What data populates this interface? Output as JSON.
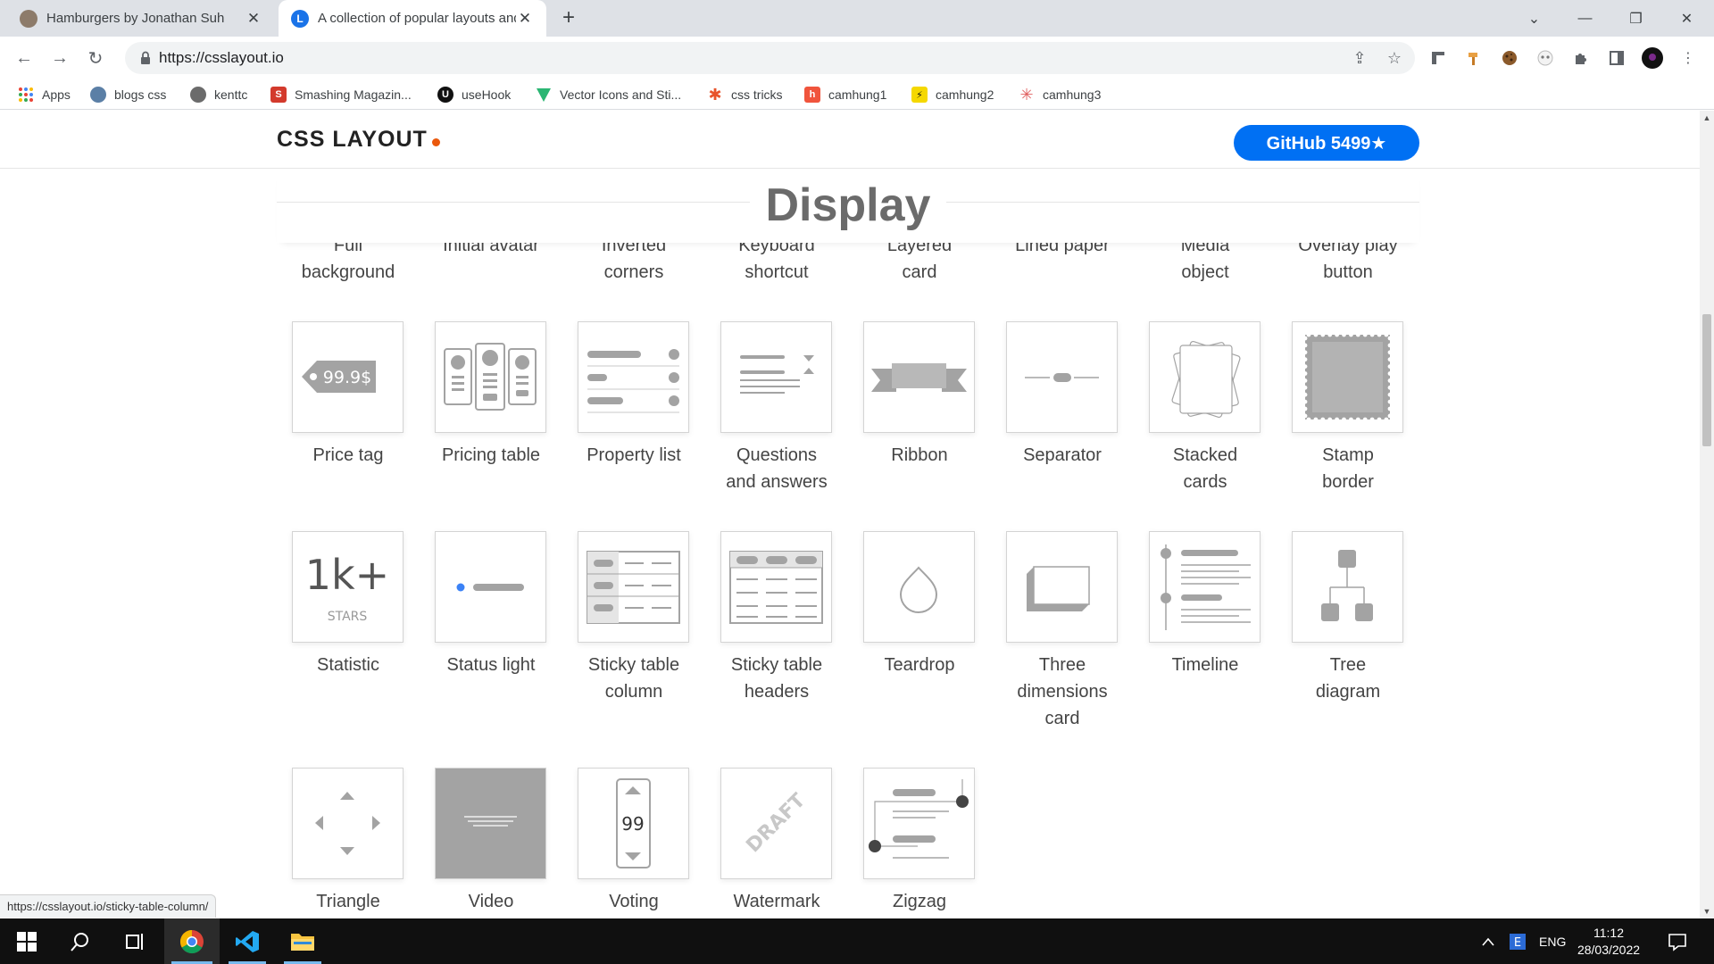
{
  "browser": {
    "tabs": [
      {
        "title": "Hamburgers by Jonathan Suh",
        "active": false
      },
      {
        "title": "A collection of popular layouts and patterns made with CSS",
        "active": true
      }
    ],
    "url": "https://csslayout.io",
    "bookmarks": [
      {
        "label": "Apps",
        "icon": "apps-grid-icon"
      },
      {
        "label": "blogs css",
        "icon": "globe-icon"
      },
      {
        "label": "kenttc",
        "icon": "koala-icon"
      },
      {
        "label": "Smashing Magazin...",
        "icon": "smashing-icon"
      },
      {
        "label": "useHook",
        "icon": "usehook-icon"
      },
      {
        "label": "Vector Icons and Sti...",
        "icon": "vector-icon"
      },
      {
        "label": "css tricks",
        "icon": "star-icon"
      },
      {
        "label": "camhung1",
        "icon": "h-icon"
      },
      {
        "label": "camhung2",
        "icon": "lightning-icon"
      },
      {
        "label": "camhung3",
        "icon": "leaf-icon"
      }
    ],
    "status_url": "https://csslayout.io/sticky-table-column/"
  },
  "site": {
    "brand": "CSS LAYOUT",
    "github_label": "GitHub 5499★",
    "section_title": "Display",
    "top_row": [
      {
        "line1": "Full",
        "line2": "background"
      },
      {
        "line1": "Initial avatar",
        "line2": ""
      },
      {
        "line1": "Inverted",
        "line2": "corners"
      },
      {
        "line1": "Keyboard",
        "line2": "shortcut"
      },
      {
        "line1": "Layered",
        "line2": "card"
      },
      {
        "line1": "Lined paper",
        "line2": ""
      },
      {
        "line1": "Media",
        "line2": "object"
      },
      {
        "line1": "Overlay play",
        "line2": "button"
      }
    ],
    "patterns": [
      {
        "name": "price-tag",
        "line1": "Price tag",
        "line2": "",
        "line3": "",
        "tag_text": "99.9$"
      },
      {
        "name": "pricing-table",
        "line1": "Pricing table",
        "line2": "",
        "line3": ""
      },
      {
        "name": "property-list",
        "line1": "Property list",
        "line2": "",
        "line3": ""
      },
      {
        "name": "questions-and-answers",
        "line1": "Questions",
        "line2": "and answers",
        "line3": ""
      },
      {
        "name": "ribbon",
        "line1": "Ribbon",
        "line2": "",
        "line3": ""
      },
      {
        "name": "separator",
        "line1": "Separator",
        "line2": "",
        "line3": ""
      },
      {
        "name": "stacked-cards",
        "line1": "Stacked",
        "line2": "cards",
        "line3": ""
      },
      {
        "name": "stamp-border",
        "line1": "Stamp",
        "line2": "border",
        "line3": ""
      },
      {
        "name": "statistic",
        "line1": "Statistic",
        "line2": "",
        "line3": "",
        "stat_value": "1k+",
        "stat_unit": "STARS"
      },
      {
        "name": "status-light",
        "line1": "Status light",
        "line2": "",
        "line3": ""
      },
      {
        "name": "sticky-table-column",
        "line1": "Sticky table",
        "line2": "column",
        "line3": ""
      },
      {
        "name": "sticky-table-headers",
        "line1": "Sticky table",
        "line2": "headers",
        "line3": ""
      },
      {
        "name": "teardrop",
        "line1": "Teardrop",
        "line2": "",
        "line3": ""
      },
      {
        "name": "three-dimensions-card",
        "line1": "Three",
        "line2": "dimensions",
        "line3": "card"
      },
      {
        "name": "timeline",
        "line1": "Timeline",
        "line2": "",
        "line3": ""
      },
      {
        "name": "tree-diagram",
        "line1": "Tree",
        "line2": "diagram",
        "line3": ""
      },
      {
        "name": "triangle",
        "line1": "Triangle",
        "line2": "",
        "line3": ""
      },
      {
        "name": "video",
        "line1": "Video",
        "line2": "",
        "line3": ""
      },
      {
        "name": "voting",
        "line1": "Voting",
        "line2": "",
        "line3": "",
        "vote_value": "99"
      },
      {
        "name": "watermark",
        "line1": "Watermark",
        "line2": "",
        "line3": "",
        "watermark_text": "DRAFT"
      },
      {
        "name": "zigzag",
        "line1": "Zigzag",
        "line2": "",
        "line3": ""
      }
    ]
  },
  "taskbar": {
    "language": "ENG",
    "time": "11:12",
    "date": "28/03/2022"
  },
  "colors": {
    "accent": "#0070f3",
    "brand_dot": "#ea580c",
    "pattern_gray": "#a3a3a3",
    "status_dot": "#3b82f6"
  }
}
